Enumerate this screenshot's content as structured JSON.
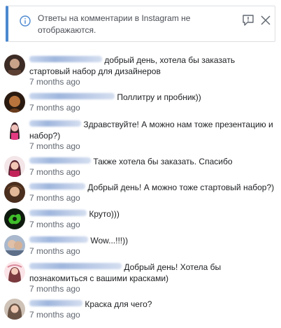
{
  "notice": {
    "text": "Ответы на комментарии в Instagram не отображаются.",
    "accent_color": "#4b88cf",
    "icons": [
      "info-icon",
      "flag-icon",
      "close-icon"
    ]
  },
  "comments": [
    {
      "text": "добрый день, хотела бы заказать стартовый набор для дизайнеров",
      "time": "7 months ago",
      "avatar_color": "#6b4a3a"
    },
    {
      "text": "Поллитру и пробник))",
      "time": "7 months ago",
      "avatar_color": "#8a5a2c"
    },
    {
      "text": "Здравствуйте! А можно нам тоже презентацию и набор?)",
      "time": "7 months ago",
      "avatar_color": "#e33a82"
    },
    {
      "text": "Также хотела бы заказать. Спасибо",
      "time": "7 months ago",
      "avatar_color": "#c2245a"
    },
    {
      "text": "Добрый день! А можно тоже стартовый набор?)",
      "time": "7 months ago",
      "avatar_color": "#7a5030"
    },
    {
      "text": "Круто)))",
      "time": "7 months ago",
      "avatar_color": "#1f6b1c"
    },
    {
      "text": "Wow...!!!))",
      "time": "7 months ago",
      "avatar_color": "#7d8fa8"
    },
    {
      "text": "Добрый день! Хотела бы познакомиться с вашими красками)",
      "time": "7 months ago",
      "avatar_color": "#d98a9a"
    },
    {
      "text": "Краска для чего?",
      "time": "7 months ago",
      "avatar_color": "#9c8a7a"
    }
  ]
}
